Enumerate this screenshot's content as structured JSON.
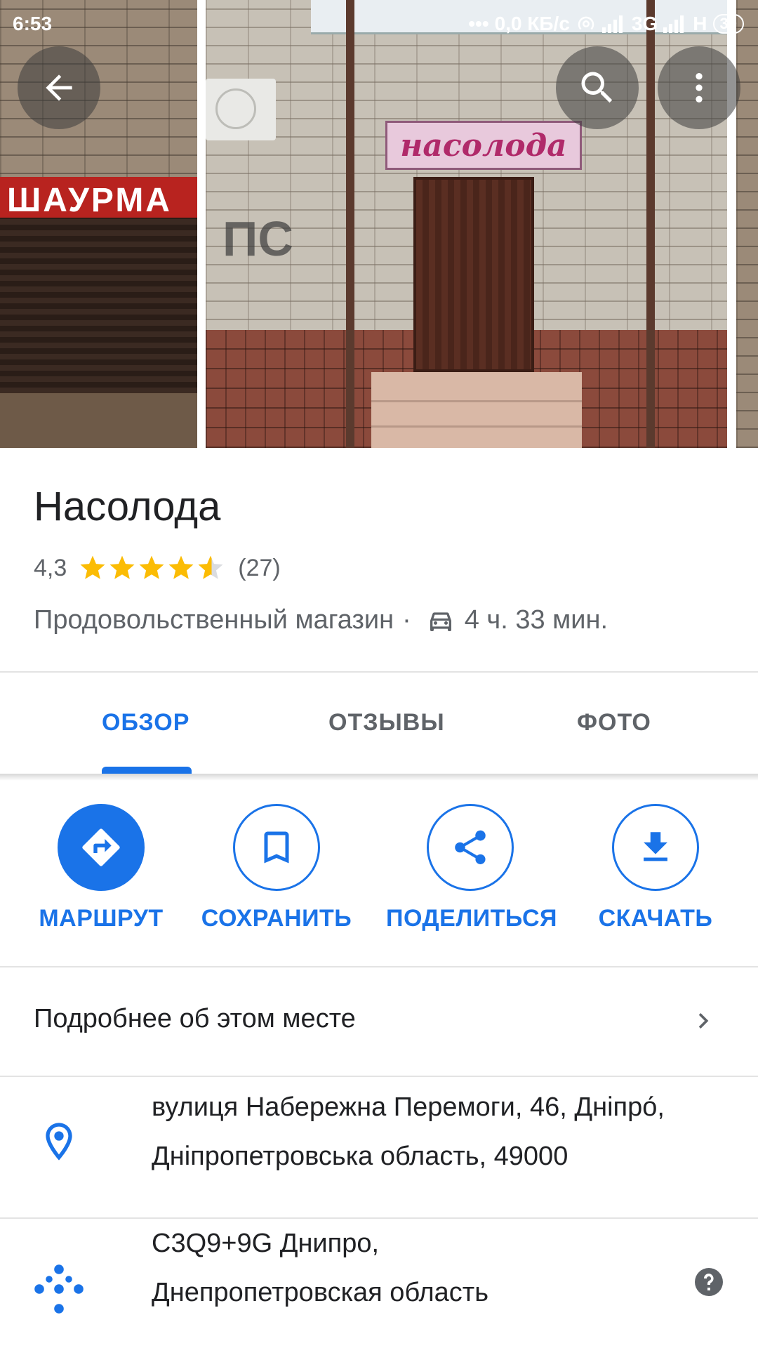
{
  "status_bar": {
    "time": "6:53",
    "dots": "•••",
    "net_speed": "0,0 КБ/с",
    "network": "3G",
    "network2": "H",
    "battery": "30"
  },
  "photos": {
    "left_sign": "ШАУРМА",
    "main_sign": "насолода",
    "graffiti": "ПС"
  },
  "place": {
    "name": "Насолода",
    "rating": "4,3",
    "rating_value": 4.3,
    "reviews_count": "(27)",
    "category": "Продовольственный магазин",
    "separator": "·",
    "drive_time": "4 ч. 33 мин."
  },
  "tabs": [
    {
      "label": "ОБЗОР",
      "active": true
    },
    {
      "label": "ОТЗЫВЫ",
      "active": false
    },
    {
      "label": "ФОТО",
      "active": false
    }
  ],
  "actions": [
    {
      "label": "МАРШРУТ",
      "icon": "directions-icon"
    },
    {
      "label": "СОХРАНИТЬ",
      "icon": "bookmark-icon"
    },
    {
      "label": "ПОДЕЛИТЬСЯ",
      "icon": "share-icon"
    },
    {
      "label": "СКАЧАТЬ",
      "icon": "download-icon"
    }
  ],
  "details": {
    "more_about": "Подробнее об этом месте",
    "address_line1": "вулиця Набережна Перемоги, 46, Дніпро́,",
    "address_line2": "Дніпропетровська область, 49000",
    "plus_code_line1": "C3Q9+9G Днипро,",
    "plus_code_line2": "Днепропетровская область"
  },
  "colors": {
    "accent": "#1a73e8",
    "star": "#fbbc04",
    "text_secondary": "#5f6368"
  }
}
